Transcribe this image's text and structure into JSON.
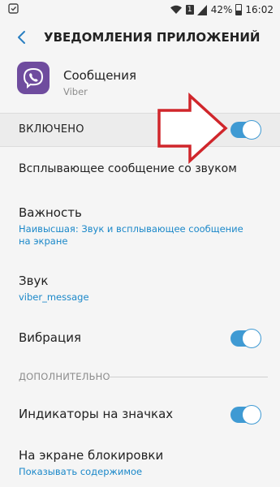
{
  "status_bar": {
    "battery_percent": "42%",
    "time": "16:02",
    "sim_label": "1",
    "icons": [
      "wifi-icon",
      "sim-icon",
      "signal-icon",
      "battery-icon"
    ]
  },
  "header": {
    "title": "УВЕДОМЛЕНИЯ ПРИЛОЖЕНИЙ"
  },
  "app": {
    "name": "Сообщения",
    "source": "Viber",
    "icon": "viber-icon",
    "brand_color": "#6f4c9e"
  },
  "enabled": {
    "label": "ВКЛЮЧЕНО",
    "on": true
  },
  "settings": {
    "popup": {
      "title": "Всплывающее сообщение со звуком"
    },
    "importance": {
      "title": "Важность",
      "value": "Наивысшая: Звук и всплывающее сообщение на экране"
    },
    "sound": {
      "title": "Звук",
      "value": "viber_message"
    },
    "vibration": {
      "title": "Вибрация",
      "on": true
    }
  },
  "advanced": {
    "section_label": "ДОПОЛНИТЕЛЬНО",
    "badges": {
      "title": "Индикаторы на значках",
      "on": true
    },
    "lockscreen": {
      "title": "На экране блокировки",
      "value": "Показывать содержимое"
    }
  },
  "colors": {
    "accent": "#3f9ad3",
    "link_text": "#1b88c9",
    "arrow_outline": "#d0262b"
  }
}
